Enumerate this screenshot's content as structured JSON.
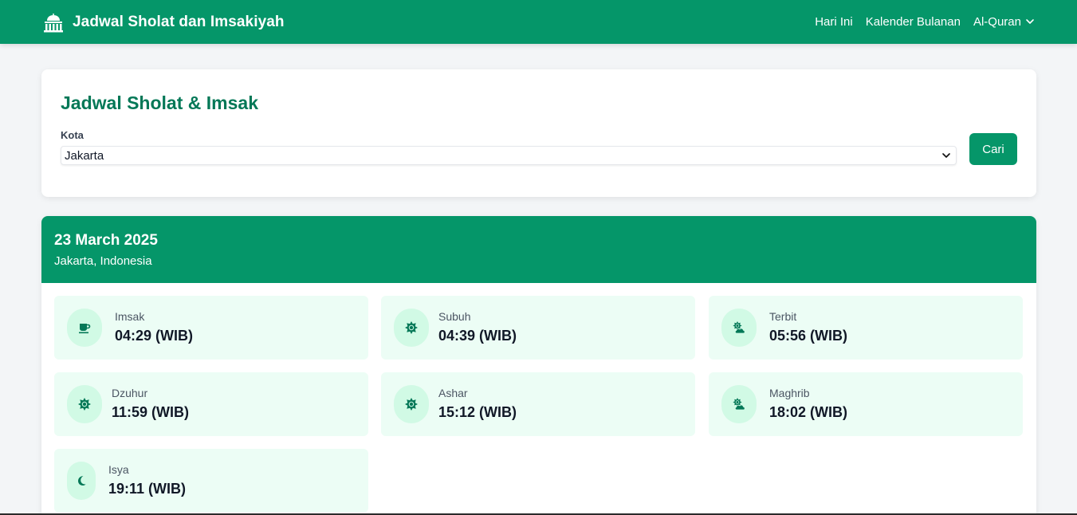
{
  "navbar": {
    "brand_title": "Jadwal Sholat dan Imsakiyah",
    "brand_icon": "mosque-icon",
    "links": [
      "Hari Ini",
      "Kalender Bulanan"
    ],
    "dropdown_label": "Al-Quran",
    "accent_color": "#059669"
  },
  "search": {
    "title": "Jadwal Sholat & Imsak",
    "city_label": "Kota",
    "city_value": "Jakarta",
    "button_label": "Cari"
  },
  "schedule": {
    "date": "23 March 2025",
    "location": "Jakarta, Indonesia",
    "prayers": [
      {
        "name": "Imsak",
        "time": "04:29 (WIB)",
        "icon": "mug-icon"
      },
      {
        "name": "Subuh",
        "time": "04:39 (WIB)",
        "icon": "sun-icon"
      },
      {
        "name": "Terbit",
        "time": "05:56 (WIB)",
        "icon": "cloud-sun-icon"
      },
      {
        "name": "Dzuhur",
        "time": "11:59 (WIB)",
        "icon": "sun-icon"
      },
      {
        "name": "Ashar",
        "time": "15:12 (WIB)",
        "icon": "sun-icon"
      },
      {
        "name": "Maghrib",
        "time": "18:02 (WIB)",
        "icon": "cloud-sun-icon"
      },
      {
        "name": "Isya",
        "time": "19:11 (WIB)",
        "icon": "moon-icon"
      }
    ]
  }
}
